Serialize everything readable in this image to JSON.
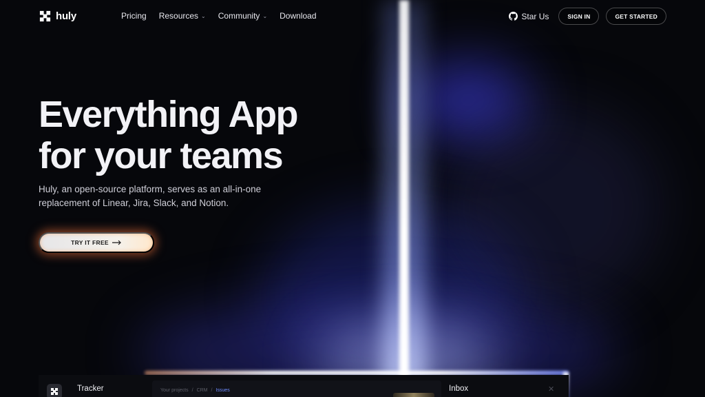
{
  "nav": {
    "brand": "huly",
    "links": [
      {
        "label": "Pricing",
        "has_dropdown": false
      },
      {
        "label": "Resources",
        "has_dropdown": true
      },
      {
        "label": "Community",
        "has_dropdown": true
      },
      {
        "label": "Download",
        "has_dropdown": false
      }
    ],
    "star_label": "Star Us",
    "sign_in": "SIGN IN",
    "get_started": "GET STARTED"
  },
  "hero": {
    "title_line1": "Everything App",
    "title_line2": "for your teams",
    "subtitle": "Huly, an open-source platform, serves as an all-in-one replacement of Linear, Jira, Slack, and Notion.",
    "cta_label": "TRY IT FREE"
  },
  "preview": {
    "tracker_label": "Tracker",
    "breadcrumbs": [
      "Your projects",
      "CRM",
      "Issues"
    ],
    "inbox_label": "Inbox"
  },
  "icons": {
    "logo": "huly-logo-icon",
    "github": "github-icon",
    "chevron": "chevron-down-icon",
    "arrow": "arrow-right-icon",
    "close": "close-icon"
  },
  "colors": {
    "background": "#06070b",
    "glow": "#5a5cff",
    "cta_glow": "#ff7a3c",
    "breadcrumb_active": "#6f8cff"
  }
}
